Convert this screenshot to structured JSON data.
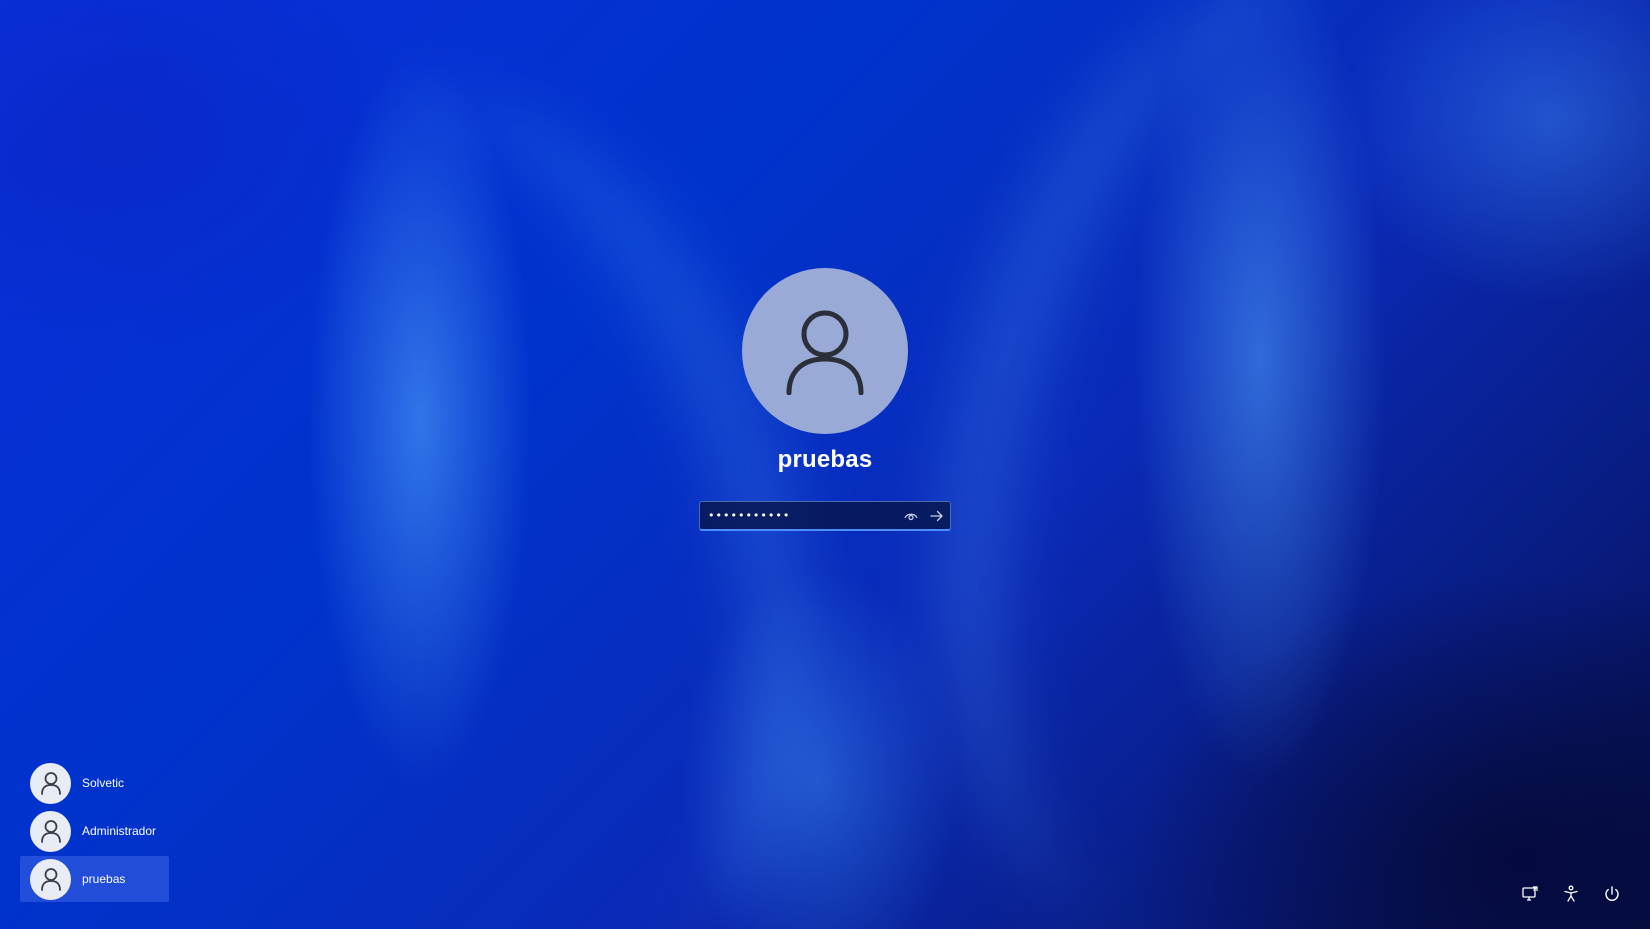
{
  "login": {
    "username": "pruebas",
    "password_value": "•••••••••••",
    "icons": {
      "avatar": "user-icon",
      "reveal": "eye-icon",
      "submit": "arrow-right-icon"
    }
  },
  "users": [
    {
      "name": "Solvetic",
      "icon": "user-icon",
      "selected": false
    },
    {
      "name": "Administrador",
      "icon": "user-icon",
      "selected": false
    },
    {
      "name": "pruebas",
      "icon": "user-icon",
      "selected": true
    }
  ],
  "system_buttons": {
    "network_icon": "network-icon",
    "accessibility_icon": "accessibility-icon",
    "power_icon": "power-icon"
  },
  "colors": {
    "background": "#0a2fc8",
    "avatar_large_bg": "#9aaad6",
    "avatar_small_bg": "#e9ecf5",
    "input_focus": "#4d8dff"
  }
}
